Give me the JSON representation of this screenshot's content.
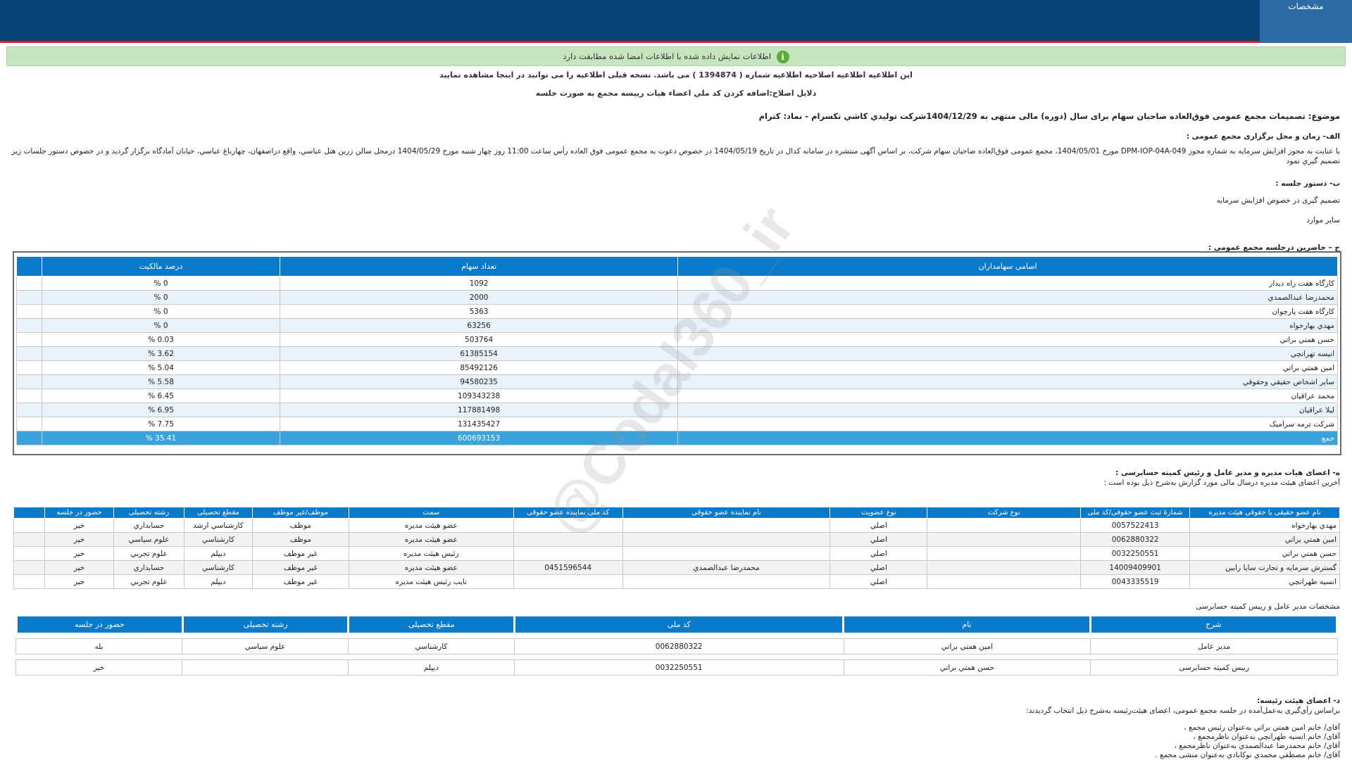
{
  "header": {
    "tab_label": "مشخصات"
  },
  "banner": {
    "text": "اطلاعات نمایش داده شده با اطلاعات امضا شده مطابقت دارد",
    "icon": "info-icon"
  },
  "notice": {
    "line1": "این اطلاعیه اطلاعیه اصلاحیه اطلاعیه شماره ( 1394874 ) می باشد. نسخه قبلی اطلاعیه را می توانید در اینجا مشاهده نمایید",
    "line2": "دلایل اصلاح:اضافه کردن کد ملي اعضاء هيات رييسه مجمع به صورت جلسه"
  },
  "subject": "موضوع: تصمیمات مجمع عمومی فوق‌العاده صاحبان سهام برای سال (دوره) مالی منتهی به 1404/12/29شرکت توليدي کاشي تکسرام - نماد: کترام",
  "section_a": {
    "title": "الف- زمان و محل برگزاری مجمع عمومی :",
    "line1": "با عنایت به مجوز افزایش سرمایه به شماره مجوز DPM-IOP-04A-049 مورخ 1404/05/01، مجمع عمومی فوق‌العاده صاحبان سهام شرکت، بر اساس آگهی منتشره در سامانه کدال در تاریخ 1404/05/19 در خصوص دعوت به مجمع عمومی فوق العاده رأس ساعت 11:00 روز چهار شنبه مورخ 1404/05/29 درمحل سالن زرين هتل عباسي، واقع دراصفهان، چهارباغ عباسي، خيابان آمادگاه   برگزار گردید و در خصوص دستور جلسات زير",
    "line2": "تصميم گيري نمود"
  },
  "section_b": {
    "title": "ب- دستور جلسه :",
    "items": [
      "تصمیم گیری در خصوص افزایش سرمایه",
      "سایر موارد"
    ]
  },
  "section_c": {
    "title": "ج – حاضرین درجلسه مجمع عمومی :",
    "headers": [
      "اسامی سهامداران",
      "تعداد سهام",
      "درصد مالکیت"
    ],
    "rows": [
      [
        "کارگاه هفت راه ديدار",
        "1092",
        "0 %"
      ],
      [
        "محمدرضا عبدالصمدي",
        "2000",
        "0 %"
      ],
      [
        "کارگاه هفت پارچوان",
        "5363",
        "0 %"
      ],
      [
        "مهدي بهارخواه",
        "63256",
        "0 %"
      ],
      [
        "حسن همتي براتي",
        "503764",
        "0.03 %"
      ],
      [
        "انيسه تهرانچي",
        "61385154",
        "3.62 %"
      ],
      [
        "امين همتي براتي",
        "85492126",
        "5.04 %"
      ],
      [
        "ساير اشخاص حقيقي وحقوقي",
        "94580235",
        "5.58 %"
      ],
      [
        "محمد عراقيان",
        "109343238",
        "6.45 %"
      ],
      [
        "ليلا عراقيان",
        "117881498",
        "6.95 %"
      ],
      [
        "شرکت ترمه سراميک",
        "131435427",
        "7.75 %"
      ]
    ],
    "total": [
      "جمع",
      "600693153",
      "35.41 %"
    ]
  },
  "section_h": {
    "title": "ه- اعضای هیات مدیره و مدیر عامل و رئیس کمیته حسابرسی :",
    "subtitle": "آخرین اعضای هیئت مدیره درسال مالی مورد گزارش به‌شرح ذیل بوده است :",
    "headers": [
      "نام عضو حقیقی یا حقوقی هیئت مدیره",
      "شمارۀ ثبت عضو حقوقی/کد ملی",
      "نوع شرکت",
      "نوع عضویت",
      "نام نماینده عضو حقوقی",
      "کد ملی نماینده عضو حقوقی",
      "سمت",
      "موظف/غیر موظف",
      "مقطع تحصیلی",
      "رشته تحصیلی",
      "حضور در جلسه"
    ],
    "rows": [
      [
        "مهدي بهارخواه",
        "0057522413",
        "",
        "اصلي",
        "",
        "",
        "عضو هيئت مديره",
        "موظف",
        "کارشناسي ارشد",
        "حسابداري",
        "خير"
      ],
      [
        "امين همتي براتي",
        "0062880322",
        "",
        "اصلي",
        "",
        "",
        "عضو هيئت مديره",
        "موظف",
        "کارشناسي",
        "علوم سياسي",
        "خير"
      ],
      [
        "حسن همتي براتي",
        "0032250551",
        "",
        "اصلي",
        "",
        "",
        "رئيس هيئت مديره",
        "غير موظف",
        "ديپلم",
        "علوم تجربي",
        "خير"
      ],
      [
        "گسترش سرمايه و تجارت سايا رابين",
        "14009409901",
        "",
        "اصلي",
        "محمدرضا عبدالصمدي",
        "0451596544",
        "عضو هيئت مديره",
        "غير موظف",
        "کارشناسي",
        "حسابداري",
        "خير"
      ],
      [
        "انسيه طهرانچي",
        "0043335519",
        "",
        "اصلي",
        "",
        "",
        "نايب رئيس هيئت مديره",
        "غير موظف",
        "ديپلم",
        "علوم تجربي",
        "خير"
      ]
    ]
  },
  "ceo": {
    "title": "مشخصات مدیر عامل و رییس کمیته حسابرسی",
    "headers": [
      "شرح",
      "نام",
      "کد ملی",
      "مقطع تحصیلی",
      "رشته تحصیلی",
      "حضور در جلسه"
    ],
    "rows": [
      [
        "مدیر عامل",
        "امين همتي براتي",
        "0062880322",
        "کارشناسي",
        "علوم سياسي",
        "بله"
      ],
      [
        "رییس کمیته حسابرسی",
        "حسن همتي براتي",
        "0032250551",
        "ديپلم",
        "",
        "خير"
      ]
    ]
  },
  "section_d": {
    "title": "د- اعضای هیئت رئیسه:",
    "intro": "براساس رأی‌گیری به‌عمل‌آمده در جلسه مجمع عمومی، اعضای هیئت‌رئیسه به‌شرح ذیل انتخاب گردیدند:",
    "lines": [
      "آقای/ خانم  امين همتي براتي  به‌عنوان رئیس مجمع ،",
      "آقای/ خانم  انسيه طهرانچي  به‌عنوان ناظرمجمع ،",
      "آقای/ خانم  محمدرضا عبدالصمدي  به‌عنوان ناظرمجمع ،",
      "آقای/ خانم  مصطفي محمدي نوکابادي  به‌عنوان منشی مجمع ."
    ]
  },
  "watermark": "@Codal360_ir"
}
